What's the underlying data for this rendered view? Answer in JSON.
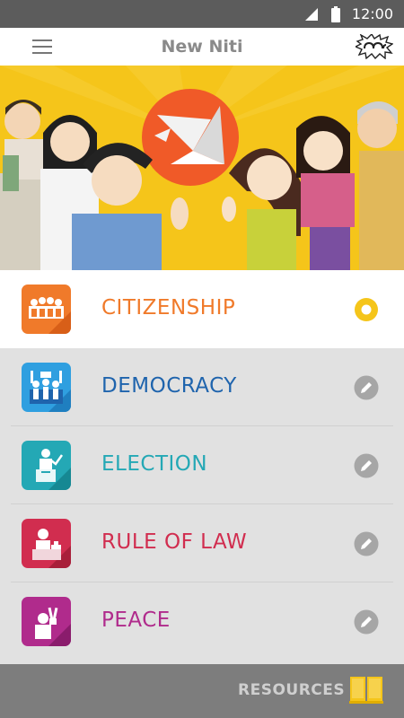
{
  "status_bar": {
    "time": "12:00",
    "icons": [
      "signal-icon",
      "battery-icon"
    ]
  },
  "app_bar": {
    "title": "New Niti",
    "menu_icon": "hamburger-menu-icon",
    "logo_icon": "app-logo-icon"
  },
  "banner": {
    "description_icon": "dove-icon",
    "accent": "#f05a28",
    "background": "#f5c51a"
  },
  "topics": [
    {
      "label": "CITIZENSHIP",
      "color": "#f07a2a",
      "icon": "group-icon",
      "status": "in-progress"
    },
    {
      "label": "DEMOCRACY",
      "color": "#1f64ad",
      "icon": "rally-icon",
      "status": "edit"
    },
    {
      "label": "ELECTION",
      "color": "#24a8b5",
      "icon": "ballot-icon",
      "status": "edit"
    },
    {
      "label": "RULE OF LAW",
      "color": "#d12d4f",
      "icon": "judge-icon",
      "status": "edit"
    },
    {
      "label": "PEACE",
      "color": "#b02b8c",
      "icon": "peace-sign-icon",
      "status": "edit"
    }
  ],
  "bottom_bar": {
    "resources_label": "RESOURCES",
    "book_icon": "book-icon",
    "book_color": "#f5c51a"
  }
}
